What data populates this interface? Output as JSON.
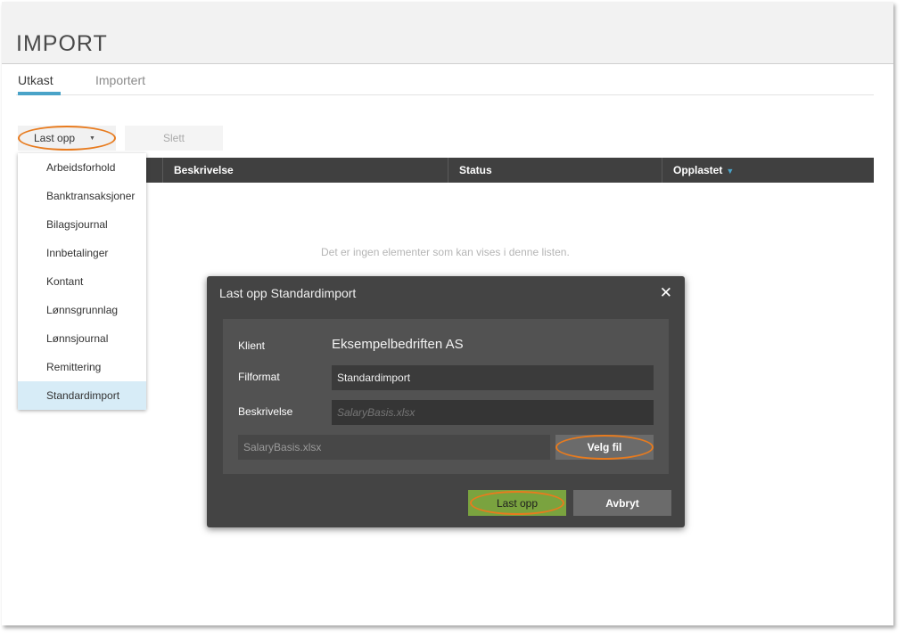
{
  "page": {
    "title": "IMPORT"
  },
  "tabs": [
    {
      "label": "Utkast",
      "active": true
    },
    {
      "label": "Importert",
      "active": false
    }
  ],
  "toolbar": {
    "upload_label": "Last opp",
    "delete_label": "Slett"
  },
  "table": {
    "columns": [
      "",
      "Beskrivelse",
      "Status",
      "Opplastet"
    ],
    "sort_column": "Opplastet",
    "empty_message": "Det er ingen elementer som kan vises i denne listen."
  },
  "upload_menu": {
    "items": [
      "Arbeidsforhold",
      "Banktransaksjoner",
      "Bilagsjournal",
      "Innbetalinger",
      "Kontant",
      "Lønnsgrunnlag",
      "Lønnsjournal",
      "Remittering",
      "Standardimport"
    ],
    "selected": "Standardimport"
  },
  "dialog": {
    "title": "Last opp Standardimport",
    "client_label": "Klient",
    "client_value": "Eksempelbedriften AS",
    "format_label": "Filformat",
    "format_value": "Standardimport",
    "description_label": "Beskrivelse",
    "description_placeholder": "SalaryBasis.xlsx",
    "file_name": "SalaryBasis.xlsx",
    "choose_file_label": "Velg fil",
    "upload_label": "Last opp",
    "cancel_label": "Avbryt"
  },
  "colors": {
    "accent": "#4aa3c8",
    "highlight_oval": "#e87b1e",
    "upload_green": "#7aa33f",
    "dialog_bg": "#444444",
    "table_header_bg": "#404040",
    "selected_item_bg": "#d7ecf7"
  },
  "icons": {
    "dropdown_caret": "caret-down-icon",
    "sort": "sort-desc-icon",
    "close": "close-icon"
  }
}
